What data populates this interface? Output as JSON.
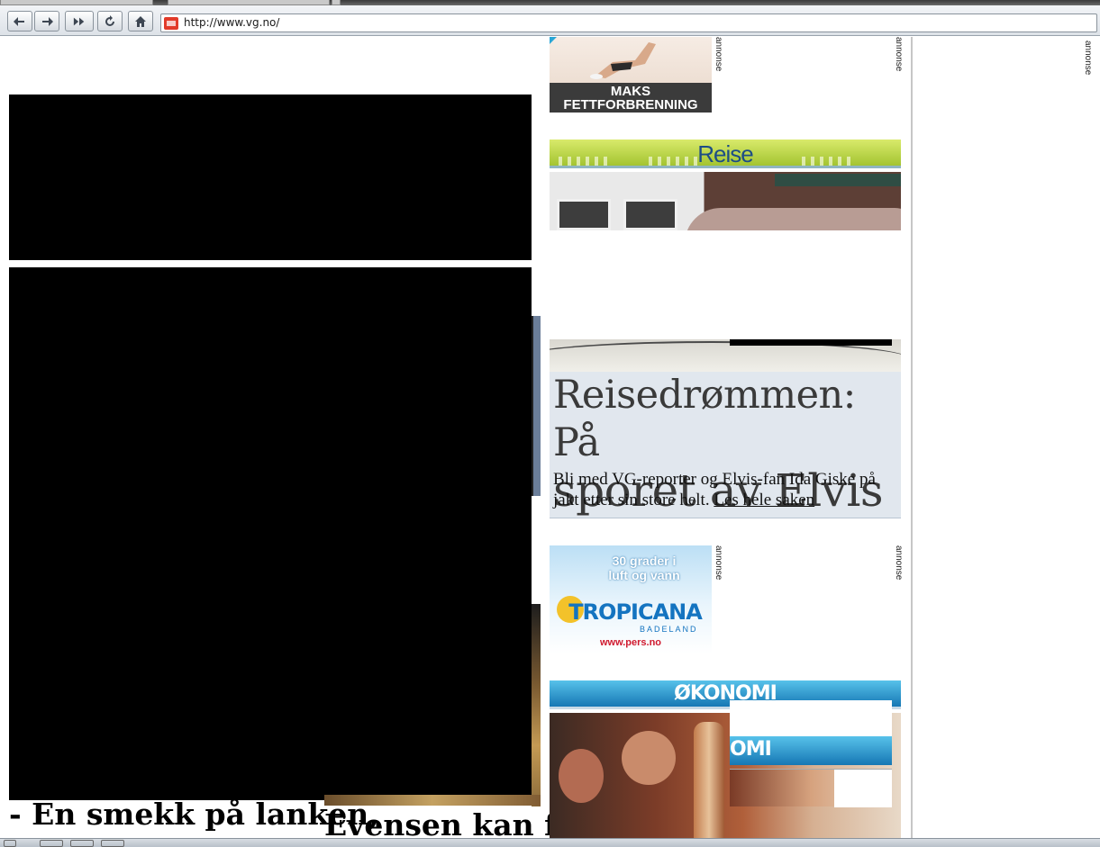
{
  "browser": {
    "url": "http://www.vg.no/",
    "nav_icons": [
      "back-icon",
      "forward-icon",
      "fast-forward-icon",
      "reload-icon",
      "home-icon"
    ]
  },
  "ads": {
    "fitness": {
      "caption_line1": "MAKS",
      "caption_line2": "FETTFORBRENNING"
    },
    "annonse_label": "annonse",
    "tropicana": {
      "headline_line1": "30 grader i",
      "headline_line2": "luft og vann",
      "brand": "TROPICANA",
      "brand_sub": "BADELAND",
      "url": "www.pers.no"
    }
  },
  "sections": {
    "reise": {
      "banner_title": "Reise"
    },
    "okonomi": {
      "banner_title": "ØKONOMI",
      "banner_fragment": "OMI"
    }
  },
  "reise_story": {
    "headline_line1": "Reisedrømmen: På",
    "headline_line2": "sporet av Elvis",
    "teaser": "Bli med VG-reporter og Elvis-fan Ida Giske på jakt etter sin store helt.",
    "link": "Les hele saken"
  },
  "headlines": {
    "left": "- En smekk på lanken,",
    "right": "Evensen kan få"
  },
  "colors": {
    "reise_banner": "#a3c431",
    "okonomi_banner": "#1677b4",
    "story_bg": "#e1e7ee"
  }
}
